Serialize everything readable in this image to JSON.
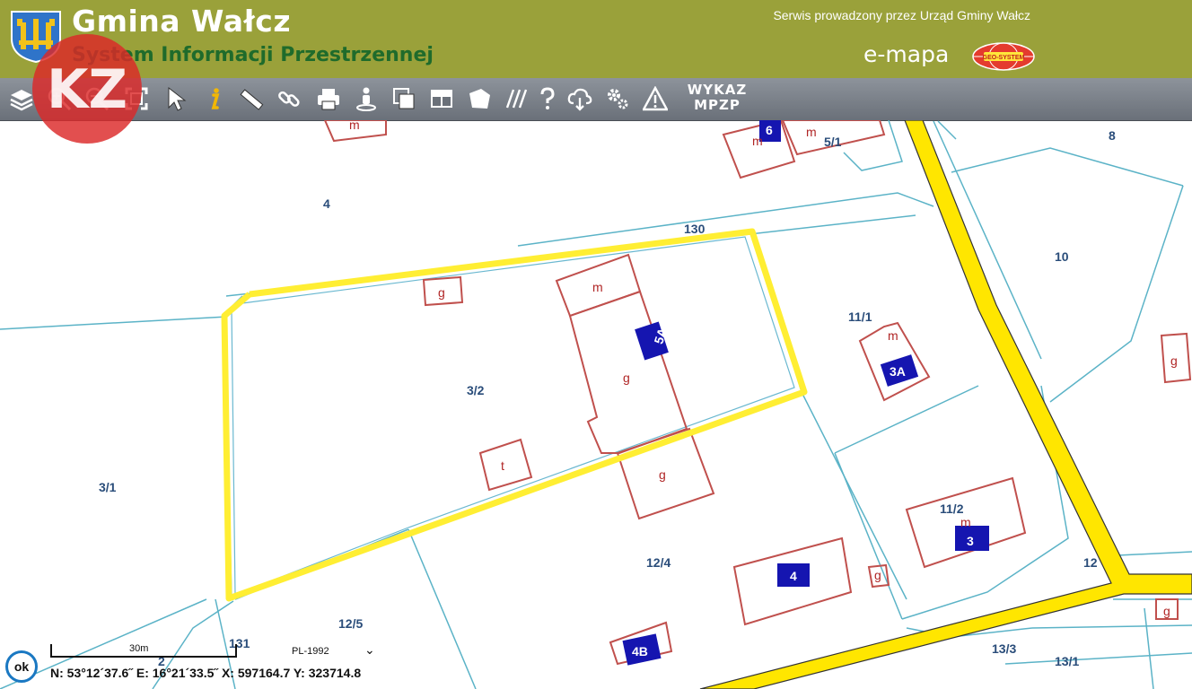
{
  "header": {
    "title": "Gmina Wałcz",
    "subtitle": "System Informacji Przestrzennej",
    "service_text": "Serwis prowadzony przez Urząd Gminy Wałcz",
    "brand": "e-mapa",
    "globe_text": "GEO-SYSTEM"
  },
  "toolbar": {
    "tools": [
      "layers-icon",
      "zoom-in-icon",
      "zoom-out-icon",
      "full-extent-icon",
      "pointer-icon",
      "info-icon",
      "measure-icon",
      "link-icon",
      "print-icon",
      "street-view-icon",
      "overview-icon",
      "layout-icon",
      "shape-icon",
      "hatch-icon",
      "help-icon",
      "cloud-download-icon",
      "settings-icon",
      "warning-icon"
    ],
    "wykaz_line1": "WYKAZ",
    "wykaz_line2": "MPZP"
  },
  "watermark": {
    "text": "KZ"
  },
  "map": {
    "parcel_labels": [
      "4",
      "130",
      "8",
      "10",
      "11/1",
      "3/2",
      "3/1",
      "12/4",
      "11/2",
      "12",
      "12/5",
      "131",
      "13/3",
      "13/1",
      "5/1",
      "2"
    ],
    "building_labels": [
      "m",
      "g",
      "m",
      "g",
      "t",
      "g",
      "m",
      "g",
      "m",
      "m",
      "g",
      "g",
      "m"
    ],
    "address_labels": [
      "5A",
      "3A",
      "3",
      "4",
      "4B",
      "6"
    ],
    "colors": {
      "parcel_line": "#5bb3c7",
      "building_line": "#c0504d",
      "road_fill": "#ffe600",
      "selection": "#ffee33",
      "address_fill": "#1515b0"
    }
  },
  "bottom": {
    "ok_label": "ok",
    "scale_label": "30m",
    "crs": "PL-1992",
    "coords": "N: 53°12´37.6˝  E: 16°21´33.5˝  X: 597164.7  Y: 323714.8"
  }
}
